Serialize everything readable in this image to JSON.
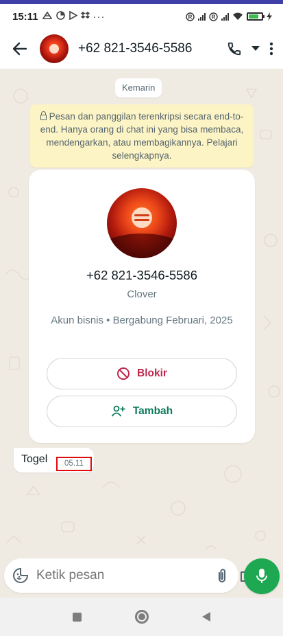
{
  "status_bar": {
    "time": "15:11",
    "more": "···",
    "battery_level": 0.8,
    "battery_color": "#3dbb4f"
  },
  "header": {
    "contact": "+62 821-3546-5586",
    "icons": [
      "back-arrow-icon",
      "call-icon",
      "dropdown-icon",
      "more-vert-icon"
    ]
  },
  "chat": {
    "date_chip": "Kemarin",
    "encryption_notice": "Pesan dan panggilan terenkripsi secara end-to-end. Hanya orang di chat ini yang bisa membaca, mendengarkan, atau membagikannya. Pelajari selengkapnya.",
    "profile_card": {
      "phone": "+62 821-3546-5586",
      "name": "Clover",
      "description": "Akun bisnis • Bergabung Februari, 2025",
      "block_label": "Blokir",
      "add_label": "Tambah"
    },
    "message": {
      "text": "Togel",
      "time": "05.11"
    }
  },
  "composer": {
    "placeholder": "Ketik pesan"
  },
  "colors": {
    "accent": "#1da851",
    "block": "#c0264a",
    "add": "#0b7a5b",
    "notice_bg": "#fdf4c5",
    "highlight_box": "#e00a0a"
  }
}
